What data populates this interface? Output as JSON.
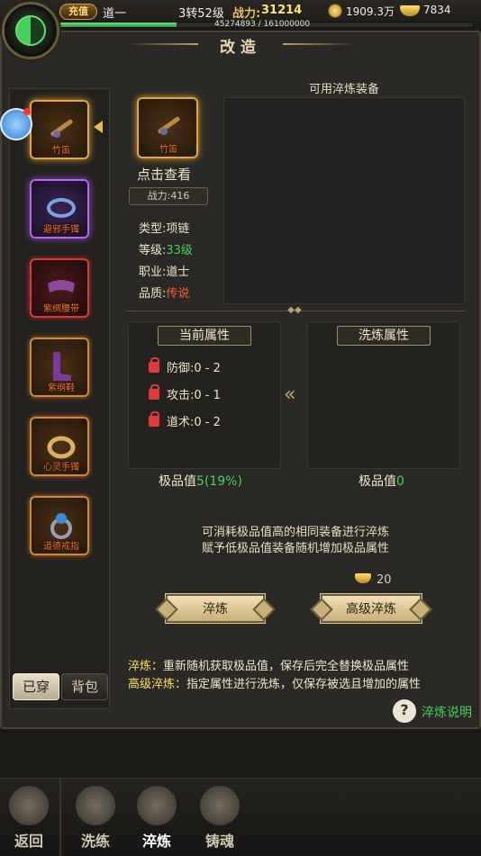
{
  "header": {
    "recharge": "充值",
    "name": "道一",
    "level": "3转52级",
    "power_label": "战力:",
    "power": "31214",
    "coins": "1909.3万",
    "ingots": "7834",
    "exp_text": "45274893 / 161000000",
    "exp_fraction": 0.281
  },
  "title": "改造",
  "sidebar": {
    "items": [
      {
        "name": "竹笛",
        "quality": "gold"
      },
      {
        "name": "避邪手镯",
        "quality": "purple"
      },
      {
        "name": "紫绸腰带",
        "quality": "red"
      },
      {
        "name": "紫纲鞋",
        "quality": "orange"
      },
      {
        "name": "心灵手镯",
        "quality": "orange"
      },
      {
        "name": "道德戒指",
        "quality": "orange"
      }
    ],
    "tabs": {
      "worn": "已穿",
      "bag": "背包"
    }
  },
  "item": {
    "name": "竹笛",
    "click_view": "点击查看",
    "power": "战力:416",
    "type_label": "类型:",
    "type": "项链",
    "level_label": "等级:",
    "level": "33级",
    "job_label": "职业:",
    "job": "道士",
    "quality_label": "品质:",
    "quality": "传说"
  },
  "available": {
    "title": "可用淬炼装备"
  },
  "current_attr": {
    "title": "当前属性",
    "lines": [
      "防御:0 - 2",
      "攻击:0 - 1",
      "道术:0 - 2"
    ],
    "grade_label": "极品值",
    "grade": "5(19%)"
  },
  "wash_attr": {
    "title": "洗炼属性",
    "grade_label": "极品值",
    "grade": "0"
  },
  "desc": {
    "line1": "可消耗极品值高的相同装备进行淬炼",
    "line2": "赋予低极品值装备随机增加极品属性"
  },
  "cost": "20",
  "buttons": {
    "quench": "淬炼",
    "advanced": "高级淬炼"
  },
  "notes": {
    "n1_key": "淬炼：",
    "n1_text": "重新随机获取极品值，保存后完全替换极品属性",
    "n2_key": "高级淬炼：",
    "n2_text": "指定属性进行洗炼，仅保存被选且增加的属性"
  },
  "help": "淬炼说明",
  "bottom_nav": {
    "back": "返回",
    "wash": "洗练",
    "quench": "淬炼",
    "soul": "铸魂"
  }
}
